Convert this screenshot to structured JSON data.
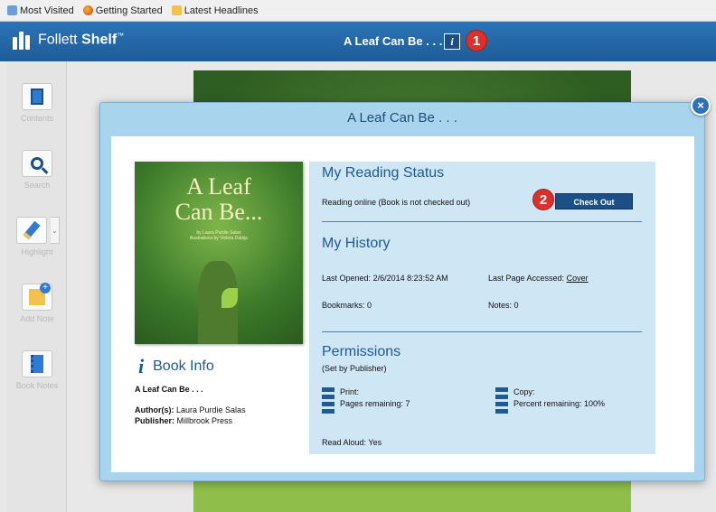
{
  "bookmarks": {
    "items": [
      {
        "label": "Most Visited",
        "icon": "visited-icon"
      },
      {
        "label": "Getting Started",
        "icon": "firefox-icon"
      },
      {
        "label": "Latest Headlines",
        "icon": "feed-icon"
      }
    ]
  },
  "header": {
    "brand_light": "Follett",
    "brand_bold": "Shelf",
    "brand_tm": "™",
    "title": "A Leaf Can Be . . .",
    "info_glyph": "i",
    "callout_1": "1"
  },
  "sidebar": {
    "tools": [
      {
        "label": "Contents"
      },
      {
        "label": "Search"
      },
      {
        "label": "Highlight"
      },
      {
        "label": "Add Note"
      },
      {
        "label": "Book Notes"
      }
    ],
    "highlight_arrow": "⌄"
  },
  "modal": {
    "title": "A Leaf Can Be . . .",
    "close_glyph": "×",
    "cover": {
      "title_line1": "A Leaf",
      "title_line2": "Can Be...",
      "credit_author": "by Laura Purdie Salas",
      "credit_illustrator": "illustrations by Violeta Dabija"
    },
    "book_info": {
      "icon_glyph": "i",
      "heading": "Book Info",
      "title": "A Leaf Can Be . . .",
      "author_label": "Author(s):",
      "author_value": "Laura Purdie Salas",
      "publisher_label": "Publisher:",
      "publisher_value": "Millbrook Press"
    },
    "reading_status": {
      "heading": "My Reading Status",
      "status_text": "Reading online (Book is not checked out)",
      "checkout_label": "Check Out",
      "callout_2": "2"
    },
    "history": {
      "heading": "My History",
      "last_opened_label": "Last Opened:",
      "last_opened_value": "2/6/2014 8:23:52 AM",
      "last_page_label": "Last Page Accessed:",
      "last_page_value": "Cover",
      "bookmarks_text": "Bookmarks: 0",
      "notes_text": "Notes: 0"
    },
    "permissions": {
      "heading": "Permissions",
      "subheading": "(Set by Publisher)",
      "print_label": "Print:",
      "print_value": "Pages remaining: 7",
      "copy_label": "Copy:",
      "copy_value": "Percent remaining: 100%",
      "read_aloud_label": "Read Aloud:",
      "read_aloud_value": "Yes"
    }
  },
  "colors": {
    "header_blue": "#2b73b6",
    "dark_blue": "#1b4f86",
    "modal_border_blue": "#a9d4ee",
    "panel_blue": "#cfe6f5",
    "callout_red": "#d9312b"
  }
}
